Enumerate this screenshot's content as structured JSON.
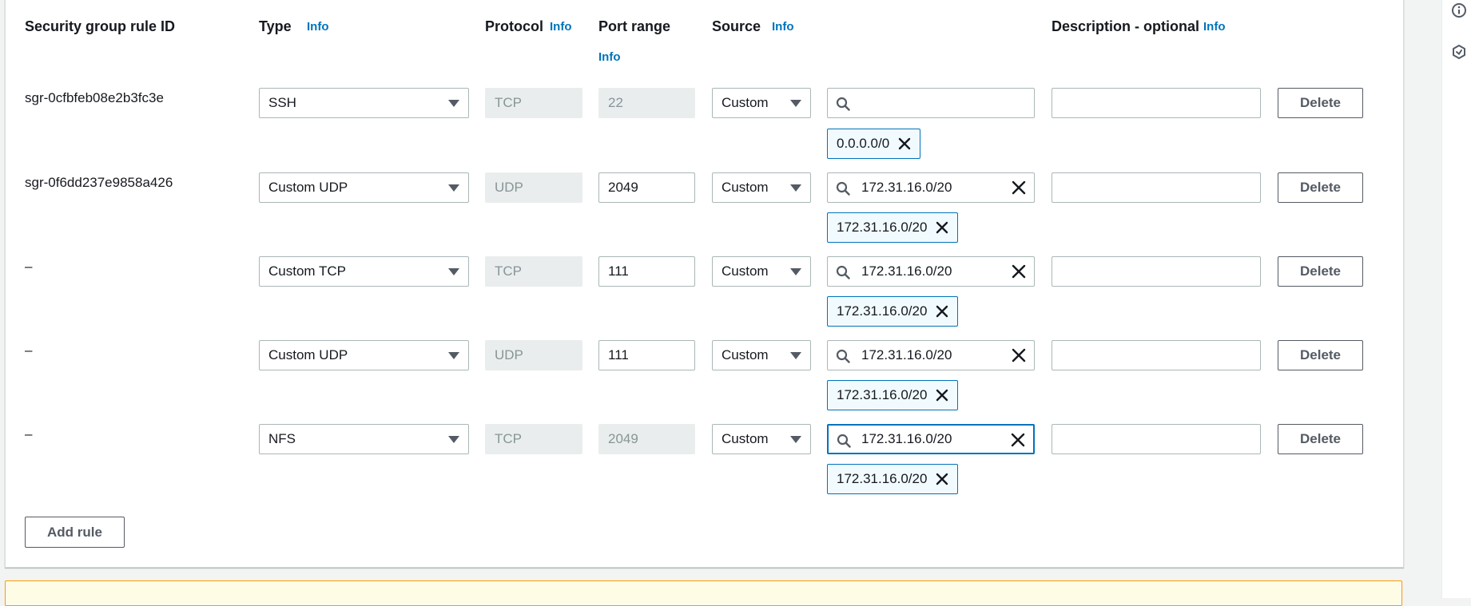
{
  "headers": {
    "rule_id": "Security group rule ID",
    "type": "Type",
    "protocol": "Protocol",
    "port_range": "Port range",
    "source": "Source",
    "description": "Description - optional",
    "info": "Info"
  },
  "rows": [
    {
      "rule_id": "sgr-0cfbfeb08e2b3fc3e",
      "type": "SSH",
      "protocol": "TCP",
      "port": "22",
      "port_editable": false,
      "source": "Custom",
      "search_value": "",
      "token": "0.0.0.0/0",
      "description": "",
      "delete_label": "Delete"
    },
    {
      "rule_id": "sgr-0f6dd237e9858a426",
      "type": "Custom UDP",
      "protocol": "UDP",
      "port": "2049",
      "port_editable": true,
      "source": "Custom",
      "search_value": "172.31.16.0/20",
      "token": "172.31.16.0/20",
      "description": "",
      "delete_label": "Delete"
    },
    {
      "rule_id": "–",
      "type": "Custom TCP",
      "protocol": "TCP",
      "port": "111",
      "port_editable": true,
      "source": "Custom",
      "search_value": "172.31.16.0/20",
      "token": "172.31.16.0/20",
      "description": "",
      "delete_label": "Delete"
    },
    {
      "rule_id": "–",
      "type": "Custom UDP",
      "protocol": "UDP",
      "port": "111",
      "port_editable": true,
      "source": "Custom",
      "search_value": "172.31.16.0/20",
      "token": "172.31.16.0/20",
      "description": "",
      "delete_label": "Delete"
    },
    {
      "rule_id": "–",
      "type": "NFS",
      "protocol": "TCP",
      "port": "2049",
      "port_editable": false,
      "source": "Custom",
      "search_value": "172.31.16.0/20",
      "token": "172.31.16.0/20",
      "description": "",
      "delete_label": "Delete"
    }
  ],
  "add_rule_label": "Add rule",
  "colors": {
    "accent": "#0073bb",
    "warning_border": "#ff9900",
    "warning_bg": "#fffce6"
  }
}
